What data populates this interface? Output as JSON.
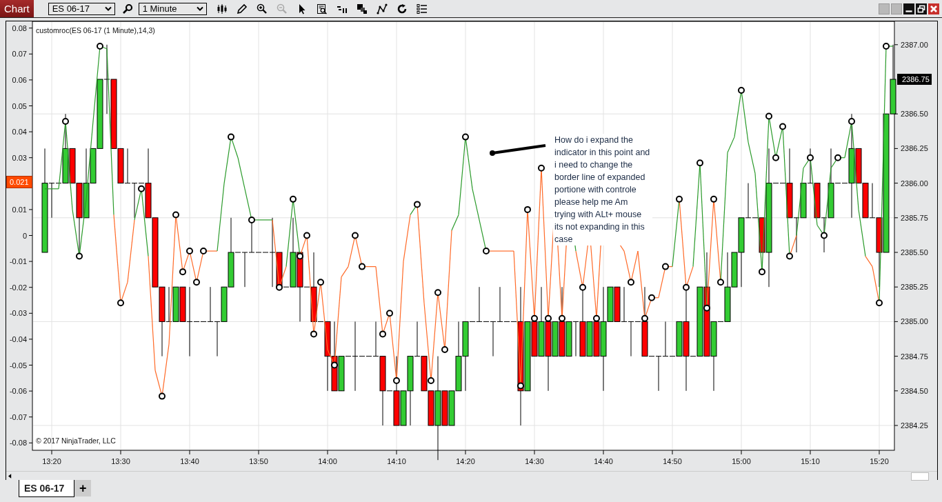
{
  "toolbar": {
    "title": "Chart",
    "instrument": "ES 06-17",
    "interval": "1 Minute"
  },
  "chart": {
    "indicator_label": "customroc(ES 06-17 (1 Minute),14,3)",
    "copyright": "© 2017 NinjaTrader, LLC",
    "left_axis": [
      "0.08",
      "0.07",
      "0.06",
      "0.05",
      "0.04",
      "0.03",
      "0.01",
      "0",
      "-0.01",
      "-0.02",
      "-0.03",
      "-0.04",
      "-0.05",
      "-0.06",
      "-0.07",
      "-0.08"
    ],
    "left_marker": "0.021",
    "right_axis": [
      "2387.00",
      "2386.50",
      "2386.25",
      "2386.00",
      "2385.75",
      "2385.50",
      "2385.25",
      "2385.00",
      "2384.75",
      "2384.50",
      "2384.25"
    ],
    "price_marker": "2386.75",
    "time_axis": [
      "13:20",
      "13:30",
      "13:40",
      "13:50",
      "14:00",
      "14:10",
      "14:20",
      "14:30",
      "14:40",
      "14:50",
      "15:00",
      "15:10",
      "15:20"
    ],
    "note": "How do i expand the indicator in this point and i need to change the border line of expanded portione with controle please help me  Am trying with ALt+ mouse its not expanding in this case"
  },
  "tabs": [
    {
      "label": "ES 06-17",
      "selected": true
    }
  ],
  "add_tab": "+"
}
